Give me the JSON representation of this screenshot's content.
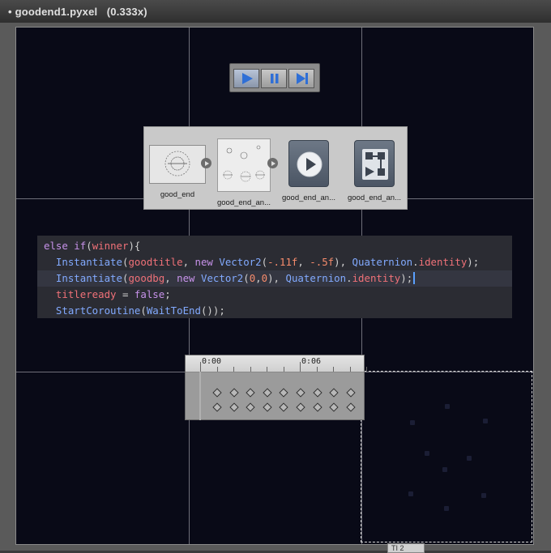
{
  "window": {
    "title": "• goodend1.pyxel   (0.333x)",
    "bottom_tab": "TI 2"
  },
  "playback": {
    "buttons": [
      {
        "name": "play",
        "icon": "play-icon",
        "active": true
      },
      {
        "name": "pause",
        "icon": "pause-icon",
        "active": false
      },
      {
        "name": "skip-to-end",
        "icon": "skip-end-icon",
        "active": false
      }
    ]
  },
  "assets": {
    "items": [
      {
        "label": "good_end",
        "icon": "sprite-thumbnail"
      },
      {
        "label": "good_end_an...",
        "icon": "sprite-sheet-thumbnail"
      },
      {
        "label": "good_end_an...",
        "icon": "animation-clip-icon"
      },
      {
        "label": "good_end_an...",
        "icon": "animator-controller-icon"
      }
    ]
  },
  "code": {
    "lines": [
      "else if(winner){",
      "  Instantiate(goodtitle, new Vector2(-.11f, -.5f), Quaternion.identity);",
      "  Instantiate(goodbg, new Vector2(0,0), Quaternion.identity);",
      "  titleready = false;",
      "  StartCoroutine(WaitToEnd());"
    ]
  },
  "timeline": {
    "labels": [
      "0:00",
      "0:06"
    ],
    "rows": 2,
    "keyframes_per_row": 9
  },
  "colors": {
    "canvas_bg": "#090a17",
    "code_bg": "#2b2c33",
    "keyword": "#c792ea",
    "type": "#82aaff",
    "identifier": "#f07178",
    "number": "#f78c6c",
    "cursor": "#5aa0ff"
  }
}
